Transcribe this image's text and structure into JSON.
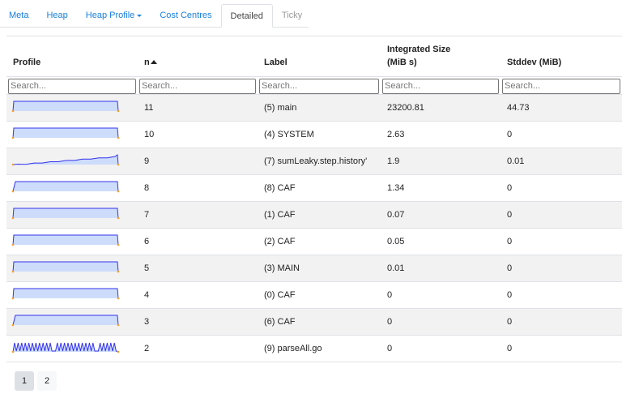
{
  "tabs": [
    {
      "label": "Meta"
    },
    {
      "label": "Heap"
    },
    {
      "label": "Heap Profile"
    },
    {
      "label": "Cost Centres"
    },
    {
      "label": "Detailed"
    },
    {
      "label": "Ticky"
    }
  ],
  "table": {
    "headers": {
      "profile": "Profile",
      "n": "n",
      "label": "Label",
      "integrated_line1": "Integrated Size",
      "integrated_line2": "(MiB s)",
      "stddev": "Stddev (MiB)"
    },
    "search_placeholder": "Search...",
    "rows": [
      {
        "shape": "flat",
        "n": "11",
        "label": "(5) main",
        "integrated": "23200.81",
        "stddev": "44.73"
      },
      {
        "shape": "flat",
        "n": "10",
        "label": "(4) SYSTEM",
        "integrated": "2.63",
        "stddev": "0"
      },
      {
        "shape": "ramp",
        "n": "9",
        "label": "(7) sumLeaky.step.history'",
        "integrated": "1.9",
        "stddev": "0.01"
      },
      {
        "shape": "step",
        "n": "8",
        "label": "(8) CAF",
        "integrated": "1.34",
        "stddev": "0"
      },
      {
        "shape": "flat",
        "n": "7",
        "label": "(1) CAF",
        "integrated": "0.07",
        "stddev": "0"
      },
      {
        "shape": "flat",
        "n": "6",
        "label": "(2) CAF",
        "integrated": "0.05",
        "stddev": "0"
      },
      {
        "shape": "flat",
        "n": "5",
        "label": "(3) MAIN",
        "integrated": "0.01",
        "stddev": "0"
      },
      {
        "shape": "flat",
        "n": "4",
        "label": "(0) CAF",
        "integrated": "0",
        "stddev": "0"
      },
      {
        "shape": "step",
        "n": "3",
        "label": "(6) CAF",
        "integrated": "0",
        "stddev": "0"
      },
      {
        "shape": "wave",
        "n": "2",
        "label": "(9) parseAll.go",
        "integrated": "0",
        "stddev": "0"
      }
    ]
  },
  "pagination": {
    "pages": [
      "1",
      "2"
    ],
    "current": "1"
  },
  "colors": {
    "spark_line": "#3333ee",
    "spark_fill": "#cddcfa",
    "spark_dot": "#f5a030",
    "link": "#1a7fe0"
  }
}
